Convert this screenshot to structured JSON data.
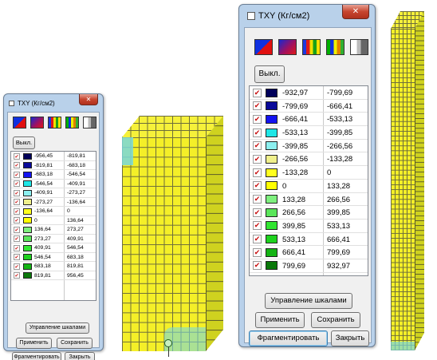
{
  "colors": {
    "window_frame": "#b9d1ea",
    "client_bg": "#f0f0f0",
    "model_yellow": "#f4ef28",
    "model_cyan_zone": "#78d7dc",
    "check_red": "#c81010"
  },
  "icons": {
    "mode_icons": [
      "split-color-icon",
      "gradient-color-icon",
      "stripe-color-icon",
      "stripe-color-alt-icon",
      "grayscale-icon"
    ],
    "check_mark": "✔",
    "close_glyph": "✕"
  },
  "small_window": {
    "title": "TXY (Кг/см2)",
    "off_button": "Выкл.",
    "rows": [
      {
        "from": "-956,45",
        "to": "-819,81",
        "color": "#00005a"
      },
      {
        "from": "-819,81",
        "to": "-683,18",
        "color": "#0a0a9a"
      },
      {
        "from": "-683,18",
        "to": "-546,54",
        "color": "#1414f0"
      },
      {
        "from": "-546,54",
        "to": "-409,91",
        "color": "#1ee6e6"
      },
      {
        "from": "-409,91",
        "to": "-273,27",
        "color": "#8cf0f0"
      },
      {
        "from": "-273,27",
        "to": "-136,64",
        "color": "#f0f08c"
      },
      {
        "from": "-136,64",
        "to": "0",
        "color": "#ffff1e"
      },
      {
        "from": "0",
        "to": "136,64",
        "color": "#ffff00"
      },
      {
        "from": "136,64",
        "to": "273,27",
        "color": "#7ef07e"
      },
      {
        "from": "273,27",
        "to": "409,91",
        "color": "#5ae65a"
      },
      {
        "from": "409,91",
        "to": "546,54",
        "color": "#32e632"
      },
      {
        "from": "546,54",
        "to": "683,18",
        "color": "#1ed21e"
      },
      {
        "from": "683,18",
        "to": "819,81",
        "color": "#14b414"
      },
      {
        "from": "819,81",
        "to": "956,45",
        "color": "#0a780a"
      }
    ],
    "scale_button": "Управление шкалами",
    "apply_button": "Применить",
    "save_button": "Сохранить",
    "fragment_button": "Фрагментировать",
    "close_button": "Закрыть"
  },
  "big_window": {
    "title": "TXY (Кг/см2)",
    "off_button": "Выкл.",
    "rows": [
      {
        "from": "-932,97",
        "to": "-799,69",
        "color": "#00005a"
      },
      {
        "from": "-799,69",
        "to": "-666,41",
        "color": "#0a0a9a"
      },
      {
        "from": "-666,41",
        "to": "-533,13",
        "color": "#1414f0"
      },
      {
        "from": "-533,13",
        "to": "-399,85",
        "color": "#1ee6e6"
      },
      {
        "from": "-399,85",
        "to": "-266,56",
        "color": "#8cf0f0"
      },
      {
        "from": "-266,56",
        "to": "-133,28",
        "color": "#f0f08c"
      },
      {
        "from": "-133,28",
        "to": "0",
        "color": "#ffff1e"
      },
      {
        "from": "0",
        "to": "133,28",
        "color": "#ffff00"
      },
      {
        "from": "133,28",
        "to": "266,56",
        "color": "#7ef07e"
      },
      {
        "from": "266,56",
        "to": "399,85",
        "color": "#5ae65a"
      },
      {
        "from": "399,85",
        "to": "533,13",
        "color": "#32e632"
      },
      {
        "from": "533,13",
        "to": "666,41",
        "color": "#1ed21e"
      },
      {
        "from": "666,41",
        "to": "799,69",
        "color": "#14b414"
      },
      {
        "from": "799,69",
        "to": "932,97",
        "color": "#0a780a"
      }
    ],
    "scale_button": "Управление шкалами",
    "apply_button": "Применить",
    "save_button": "Сохранить",
    "fragment_button": "Фрагментировать",
    "close_button": "Закрыть"
  }
}
